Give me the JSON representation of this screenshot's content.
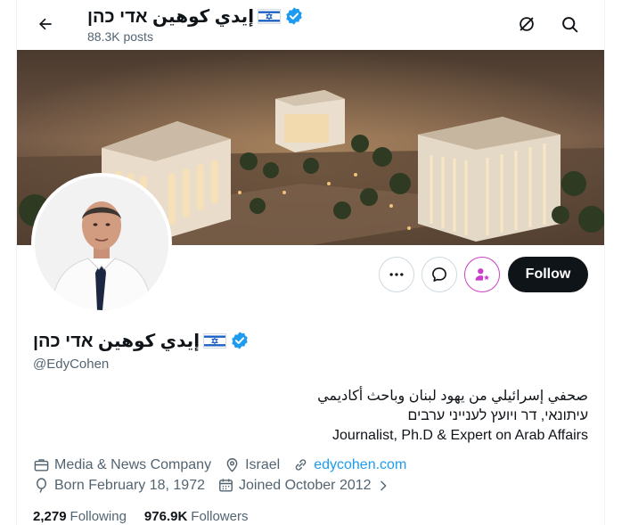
{
  "header": {
    "name": "إيدي كوهين אדי כהן",
    "posts_count": "88.3K posts"
  },
  "profile": {
    "display_name": "إيدي كوهين אדי כהן",
    "handle": "@EdyCohen",
    "follow_label": "Follow",
    "bio_lines": [
      "صحفي إسرائيلي من يهود لبنان وباحث أكاديمي",
      "עיתונאי, דר ויועץ לענייני ערבים",
      "Journalist, Ph.D & Expert on Arab Affairs"
    ],
    "category": "Media & News Company",
    "location": "Israel",
    "website": "edycohen.com",
    "birthday": "Born February 18, 1972",
    "joined": "Joined October 2012",
    "following_count": "2,279",
    "following_label": "Following",
    "followers_count": "976.9K",
    "followers_label": "Followers"
  },
  "colors": {
    "verified": "#1d9bf0",
    "link": "#1d9bf0",
    "follow_bg": "#0f1419",
    "subscribe_accent": "#c93fc9",
    "muted_text": "#536471"
  },
  "icons": {
    "back": "arrow-left-icon",
    "dont_follow": "slashed-circle-icon",
    "search": "search-icon",
    "more": "more-horizontal-icon",
    "message": "message-bubble-icon",
    "subscribe": "person-star-icon",
    "category": "briefcase-icon",
    "location": "location-pin-icon",
    "website": "link-icon",
    "birthday": "balloon-icon",
    "joined": "calendar-icon",
    "verified": "verified-badge-icon",
    "flag": "israel-flag-icon"
  }
}
